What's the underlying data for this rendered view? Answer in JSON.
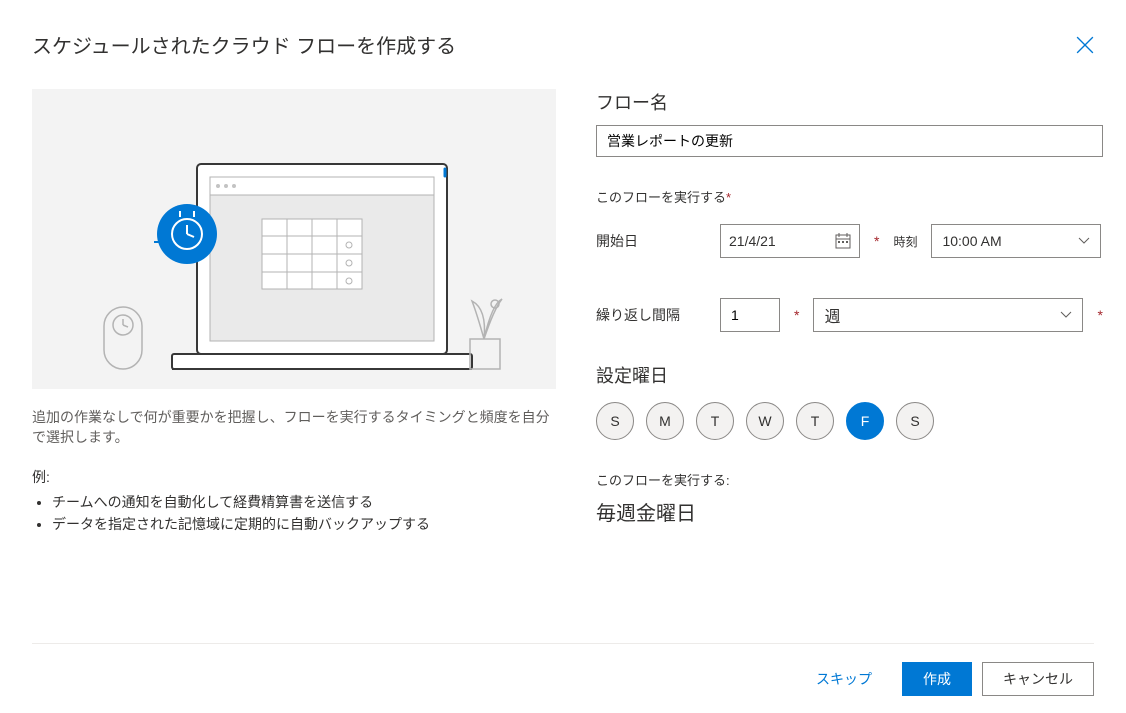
{
  "dialog": {
    "title": "スケジュールされたクラウド フローを作成する"
  },
  "left": {
    "description": "追加の作業なしで何が重要かを把握し、フローを実行するタイミングと頻度を自分で選択します。",
    "examples_heading": "例:",
    "examples": [
      "チームへの通知を自動化して経費精算書を送信する",
      "データを指定された記憶域に定期的に自動バックアップする"
    ]
  },
  "form": {
    "flow_name_label": "フロー名",
    "flow_name_value": "営業レポートの更新",
    "run_group_label": "このフローを実行する",
    "start_date_label": "開始日",
    "start_date_value": "21/4/21",
    "time_label": "時刻",
    "time_value": "10:00 AM",
    "repeat_label": "繰り返し間隔",
    "repeat_value": "1",
    "repeat_unit": "週",
    "days_label": "設定曜日",
    "days": [
      {
        "label": "S",
        "selected": false
      },
      {
        "label": "M",
        "selected": false
      },
      {
        "label": "T",
        "selected": false
      },
      {
        "label": "W",
        "selected": false
      },
      {
        "label": "T",
        "selected": false
      },
      {
        "label": "F",
        "selected": true
      },
      {
        "label": "S",
        "selected": false
      }
    ],
    "run_summary_label": "このフローを実行する:",
    "run_summary": "毎週金曜日"
  },
  "footer": {
    "skip": "スキップ",
    "create": "作成",
    "cancel": "キャンセル"
  }
}
